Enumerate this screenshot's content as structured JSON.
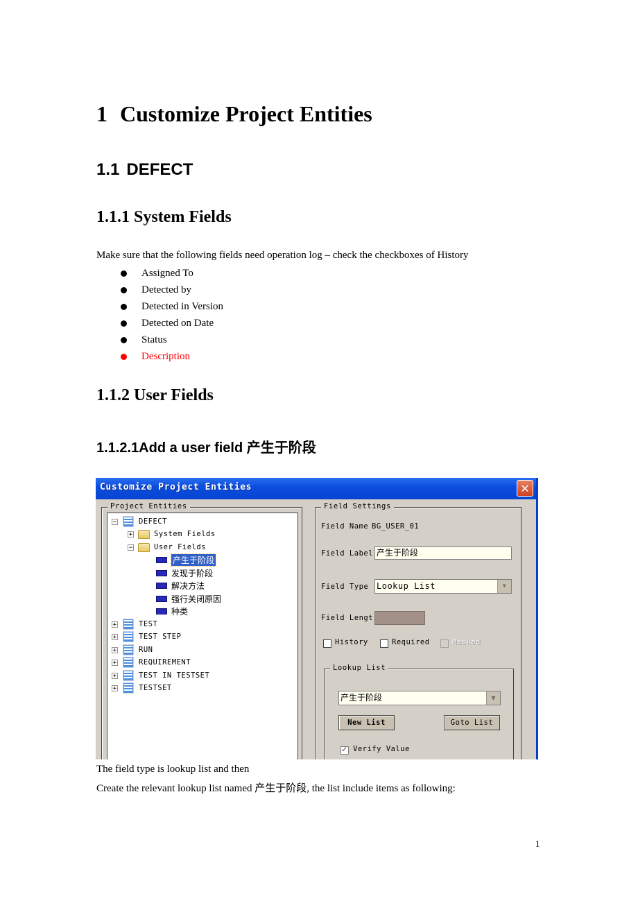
{
  "document": {
    "h1": {
      "number": "1",
      "text": "Customize Project Entities"
    },
    "h2": {
      "number": "1.1",
      "text": "DEFECT"
    },
    "h3_system": "1.1.1 System Fields",
    "intro": "Make sure that the following fields need operation log – check the checkboxes of History",
    "history_fields": [
      {
        "label": "Assigned To",
        "color": "#000000"
      },
      {
        "label": "Detected by",
        "color": "#000000"
      },
      {
        "label": "Detected in Version",
        "color": "#000000"
      },
      {
        "label": "Detected on Date",
        "color": "#000000"
      },
      {
        "label": "Status",
        "color": "#000000"
      },
      {
        "label": "Description",
        "color": "#ff0000"
      }
    ],
    "h3_user": "1.1.2 User Fields",
    "h4": "1.1.2.1Add a user field  产生于阶段",
    "after_text_1": "The field type is lookup list and then",
    "after_text_2": "Create the relevant lookup list named  产生于阶段, the list include items as following:",
    "page_number": "1"
  },
  "dialog": {
    "title": "Customize Project Entities",
    "close_symbol": "✕",
    "entities_group_label": "Project Entities",
    "tree": {
      "root": "DEFECT",
      "system_fields": "System Fields",
      "user_fields": "User Fields",
      "user_field_items": [
        "产生于阶段",
        "发现于阶段",
        "解决方法",
        "强行关闭原因",
        "种类"
      ],
      "selected_index": 0,
      "other_entities": [
        "TEST",
        "TEST STEP",
        "RUN",
        "REQUIREMENT",
        "TEST IN TESTSET",
        "TESTSET"
      ]
    },
    "settings_group_label": "Field Settings",
    "field_name_label": "Field Name",
    "field_name_value": "BG_USER_01",
    "field_label_label": "Field Label",
    "field_label_value": "产生于阶段",
    "field_type_label": "Field Type",
    "field_type_value": "Lookup List",
    "field_length_label": "Field Lengt",
    "checkboxes": {
      "history": {
        "label": "History",
        "checked": false
      },
      "required": {
        "label": "Required",
        "checked": false
      },
      "masked": {
        "label": "Masked",
        "checked": false,
        "disabled": true
      }
    },
    "lookup_group_label": "Lookup List",
    "lookup_value": "产生于阶段",
    "new_list_button": "New List",
    "goto_list_button": "Goto List",
    "verify_value": {
      "label": "Verify Value",
      "checked": true
    },
    "dropdown_arrow": "▼"
  }
}
